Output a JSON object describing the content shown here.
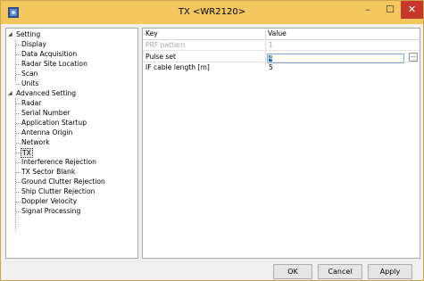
{
  "window": {
    "title": "TX <WR2120>",
    "min_symbol": "–",
    "max_symbol": "☐",
    "close_symbol": "✕"
  },
  "tree": {
    "groups": [
      {
        "label": "Setting",
        "toggle": "◢",
        "items": [
          "Display",
          "Data Acquisition",
          "Radar Site Location",
          "Scan",
          "Units"
        ]
      },
      {
        "label": "Advanced Setting",
        "toggle": "◢",
        "items": [
          "Radar",
          "Serial Number",
          "Application Startup",
          "Antenna Origin",
          "Network",
          "TX",
          "Interference Rejection",
          "TX Sector Blank",
          "Ground Clutter Rejection",
          "Ship Clutter Rejection",
          "Doppler Velocity",
          "Signal Processing"
        ]
      }
    ],
    "selected": "TX"
  },
  "grid": {
    "headers": {
      "key": "Key",
      "value": "Value"
    },
    "rows": [
      {
        "key": "PRF pattern",
        "value": "1",
        "disabled": true
      },
      {
        "key": "Pulse set",
        "value": "4",
        "editing": true
      },
      {
        "key": "IF cable length [m]",
        "value": "5"
      }
    ],
    "ellipsis_label": "..."
  },
  "buttons": {
    "ok": "OK",
    "cancel": "Cancel",
    "apply": "Apply"
  },
  "colors": {
    "titlebar": "#f3c65e",
    "close": "#c7372a",
    "edit_highlight": "#1d5fb8"
  }
}
